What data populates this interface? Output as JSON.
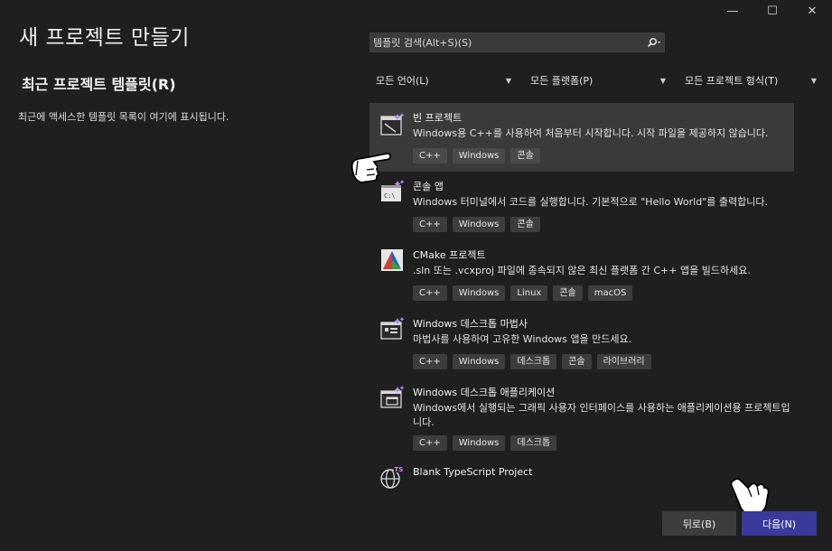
{
  "window": {
    "minimize_glyph": "—",
    "maximize_glyph": "☐",
    "close_glyph": "✕"
  },
  "page_title": "새 프로젝트 만들기",
  "recent": {
    "title": "최근 프로젝트 템플릿(R)",
    "description": "최근에 액세스한 템플릿 목록이 여기에 표시됩니다."
  },
  "search": {
    "placeholder": "템플릿 검색(Alt+S)(S)",
    "value": ""
  },
  "filters": [
    {
      "label": "모든 언어(L)"
    },
    {
      "label": "모든 플랫폼(P)"
    },
    {
      "label": "모든 프로젝트 형식(T)"
    }
  ],
  "templates": [
    {
      "name": "빈 프로젝트",
      "desc": "Windows용 C++를 사용하여 처음부터 시작합니다. 시작 파일을 제공하지 않습니다.",
      "tags": [
        "C++",
        "Windows",
        "콘솔"
      ],
      "icon": "empty-project-icon"
    },
    {
      "name": "콘솔 앱",
      "desc": "Windows 터미널에서 코드를 실행합니다. 기본적으로 \"Hello World\"를 출력합니다.",
      "tags": [
        "C++",
        "Windows",
        "콘솔"
      ],
      "icon": "console-app-icon"
    },
    {
      "name": "CMake 프로젝트",
      "desc": ".sln 또는 .vcxproj 파일에 종속되지 않은 최신 플랫폼 간 C++ 앱을 빌드하세요.",
      "tags": [
        "C++",
        "Windows",
        "Linux",
        "콘솔",
        "macOS"
      ],
      "icon": "cmake-icon"
    },
    {
      "name": "Windows 데스크톱 마법사",
      "desc": "마법사를 사용하여 고유한 Windows 앱을 만드세요.",
      "tags": [
        "C++",
        "Windows",
        "데스크톱",
        "콘솔",
        "라이브러리"
      ],
      "icon": "desktop-wizard-icon"
    },
    {
      "name": "Windows 데스크톱 애플리케이션",
      "desc": "Windows에서 실행되는 그래픽 사용자 인터페이스를 사용하는 애플리케이션용 프로젝트입니다.",
      "tags": [
        "C++",
        "Windows",
        "데스크톱"
      ],
      "icon": "desktop-app-icon"
    },
    {
      "name": "Blank TypeScript Project",
      "desc": "",
      "tags": [],
      "icon": "typescript-icon"
    }
  ],
  "buttons": {
    "back": "뒤로(B)",
    "next": "다음(N)"
  },
  "colors": {
    "background": "#1f1f1f",
    "selected": "#3a3a3a",
    "primary_button": "#3a3a9a",
    "icon_accent": "#b48ef0"
  }
}
